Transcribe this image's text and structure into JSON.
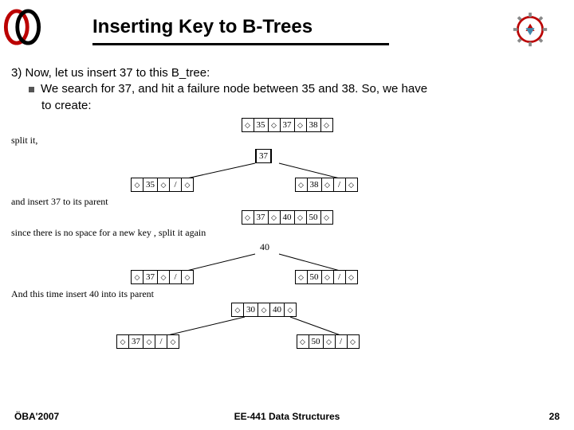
{
  "header": {
    "title": "Inserting Key to B-Trees"
  },
  "body": {
    "line1": "3) Now, let us insert 37 to this B_tree:",
    "bullet_a": "We search for 37, and hit a failure node between 35 and 38. So, we have",
    "bullet_b": "to create:"
  },
  "diagram": {
    "row1_cells": [
      "35",
      "37",
      "38"
    ],
    "caption1": "split it,",
    "promoted1": "37",
    "left_child1": [
      "35",
      "/"
    ],
    "right_child1": [
      "38",
      "/"
    ],
    "caption2": "and  insert  37 to its  parent",
    "row3_cells": [
      "37",
      "40",
      "50"
    ],
    "caption3": "since there is no space for a new key , split it again",
    "promoted2": "40",
    "left_child2": [
      "37",
      "/"
    ],
    "right_child2": [
      "50",
      "/"
    ],
    "caption4": "And  this time insert 40 into its parent",
    "row5_cells": [
      "30",
      "40"
    ],
    "bottom_left": [
      "37",
      "/"
    ],
    "bottom_right": [
      "50",
      "/"
    ]
  },
  "footer": {
    "left": "ÖBA'2007",
    "center": "EE-441 Data Structures",
    "right": "28"
  },
  "icons": {
    "logo_left": "metu-logo",
    "logo_right": "gear-icon"
  }
}
